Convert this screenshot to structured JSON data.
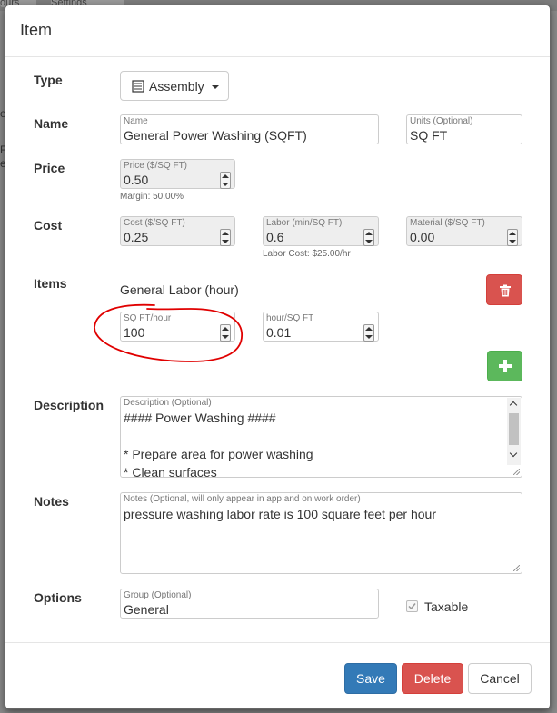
{
  "background": {
    "tab1": "ours",
    "tab2": "Settings"
  },
  "modal": {
    "title": "Item",
    "type": {
      "label": "Type",
      "value": "Assembly",
      "icon": "list-icon"
    },
    "name": {
      "label": "Name",
      "field_label": "Name",
      "value": "General Power Washing (SQFT)",
      "units_label": "Units (Optional)",
      "units_value": "SQ FT"
    },
    "price": {
      "label": "Price",
      "field_label": "Price ($/SQ FT)",
      "value": "0.50",
      "margin": "Margin: 50.00%"
    },
    "cost": {
      "label": "Cost",
      "cost_label": "Cost ($/SQ FT)",
      "cost_value": "0.25",
      "labor_label": "Labor (min/SQ FT)",
      "labor_value": "0.6",
      "labor_cost": "Labor Cost: $25.00/hr",
      "material_label": "Material ($/SQ FT)",
      "material_value": "0.00"
    },
    "items": {
      "label": "Items",
      "item_name": "General Labor (hour)",
      "rate_label": "SQ FT/hour",
      "rate_value": "100",
      "per_label": "hour/SQ FT",
      "per_value": "0.01"
    },
    "description": {
      "label": "Description",
      "field_label": "Description (Optional)",
      "lines": [
        "#### Power Washing ####",
        "",
        "* Prepare area for power washing",
        "* Clean surfaces"
      ]
    },
    "notes": {
      "label": "Notes",
      "field_label": "Notes (Optional, will only appear in app and on work order)",
      "value": "pressure washing labor rate is 100 square feet per hour"
    },
    "options": {
      "label": "Options",
      "group_label": "Group (Optional)",
      "group_value": "General",
      "taxable_label": "Taxable",
      "taxable_checked": true
    },
    "footer": {
      "save": "Save",
      "delete": "Delete",
      "cancel": "Cancel"
    }
  },
  "colors": {
    "primary": "#337ab7",
    "danger": "#d9534f",
    "success": "#5cb85c",
    "annotation": "#e00000"
  }
}
